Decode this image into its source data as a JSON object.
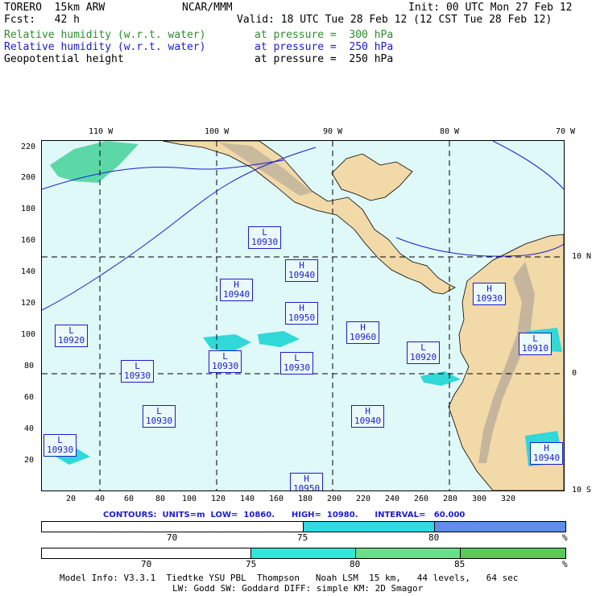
{
  "header": {
    "model": "TORERO  15km ARW",
    "org": "NCAR/MMM",
    "init": "Init: 00 UTC Mon 27 Feb 12",
    "fcst": "Fcst:   42 h",
    "valid": "Valid: 18 UTC Tue 28 Feb 12 (12 CST Tue 28 Feb 12)",
    "fields": [
      {
        "name": "Relative humidity (w.r.t. water)",
        "pressure": "at pressure =  300 hPa",
        "color": "#2e8b2e"
      },
      {
        "name": "Relative humidity (w.r.t. water)",
        "pressure": "at pressure =  250 hPa",
        "color": "#1c1ccc"
      },
      {
        "name": "Geopotential height",
        "pressure": "at pressure =  250 hPa",
        "color": "#000000"
      }
    ]
  },
  "axes": {
    "lon_top": [
      "110 W",
      "100 W",
      "90 W",
      "80 W",
      "70 W"
    ],
    "lat_right": [
      "10 N",
      "0",
      "10 S"
    ],
    "y_ticks": [
      "220",
      "200",
      "180",
      "160",
      "140",
      "120",
      "100",
      "80",
      "60",
      "40",
      "20"
    ],
    "x_ticks": [
      "20",
      "40",
      "60",
      "80",
      "100",
      "120",
      "140",
      "160",
      "180",
      "200",
      "220",
      "240",
      "260",
      "280",
      "300",
      "320"
    ]
  },
  "pressure_centers": [
    {
      "type": "L",
      "value": "10930"
    },
    {
      "type": "H",
      "value": "10940"
    },
    {
      "type": "H",
      "value": "10940"
    },
    {
      "type": "H",
      "value": "10950"
    },
    {
      "type": "H",
      "value": "10960"
    },
    {
      "type": "L",
      "value": "10920"
    },
    {
      "type": "L",
      "value": "10930"
    },
    {
      "type": "L",
      "value": "10930"
    },
    {
      "type": "L",
      "value": "10930"
    },
    {
      "type": "L",
      "value": "10920"
    },
    {
      "type": "H",
      "value": "10930"
    },
    {
      "type": "L",
      "value": "10910"
    },
    {
      "type": "L",
      "value": "10930"
    },
    {
      "type": "H",
      "value": "10940"
    },
    {
      "type": "L",
      "value": "10930"
    },
    {
      "type": "H",
      "value": "10940"
    },
    {
      "type": "H",
      "value": "10950"
    }
  ],
  "contours": {
    "text": "CONTOURS:  UNITS=m  LOW=  10860.      HIGH=  10980.      INTERVAL=   60.000"
  },
  "legend_blue": {
    "labels": [
      "70",
      "75",
      "80"
    ],
    "unit": "%",
    "colors": [
      "#ffffff",
      "#30d8e8",
      "#5b8fe8"
    ]
  },
  "legend_green": {
    "labels": [
      "70",
      "75",
      "80",
      "85"
    ],
    "unit": "%",
    "colors": [
      "#ffffff",
      "#2ee8d8",
      "#66e08a",
      "#5cc85c"
    ]
  },
  "footer": {
    "line1": "Model Info: V3.3.1  Tiedtke YSU PBL  Thompson   Noah LSM  15 km,   44 levels,   64 sec",
    "line2": "LW: Godd SW: Goddard DIFF: simple KM: 2D Smagor"
  }
}
